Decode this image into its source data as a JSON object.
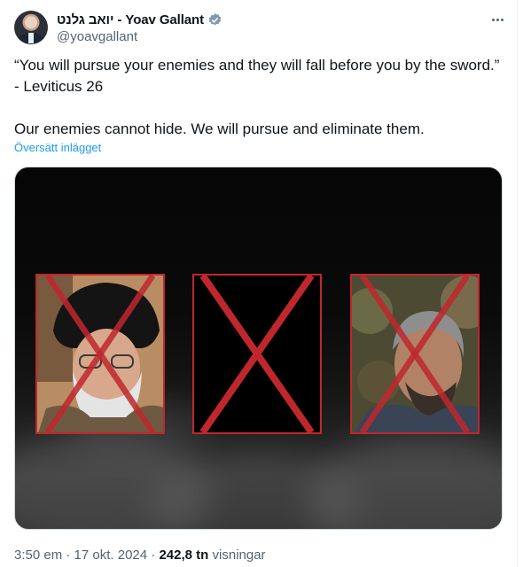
{
  "tweet": {
    "author": {
      "display_name": "יואב גלנט - Yoav Gallant",
      "handle": "@yoavgallant",
      "verified_icon": "verified-badge-icon"
    },
    "text": "“You will pursue your enemies and they will fall before you by the sword.”\n- Leviticus 26\n\nOur enemies cannot hide. We will pursue and eliminate them.",
    "translate_label": "Översätt inlägget",
    "time": "3:50 em",
    "separator": "·",
    "date": "17 okt. 2024",
    "views_count": "242,8 tn",
    "views_label": "visningar"
  },
  "colors": {
    "link": "#1d9bf0",
    "cross": "#c0272d",
    "muted": "#536471"
  }
}
